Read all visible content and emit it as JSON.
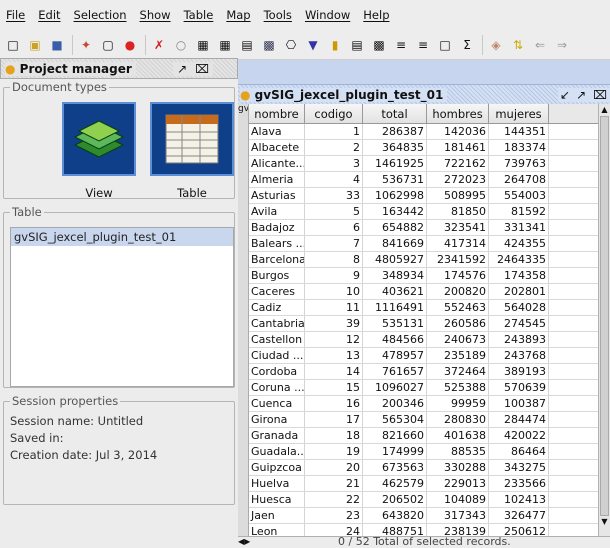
{
  "menu": [
    "File",
    "Edit",
    "Selection",
    "Show",
    "Table",
    "Map",
    "Tools",
    "Window",
    "Help"
  ],
  "toolbar_icons": [
    "new-icon",
    "open-icon",
    "save-icon",
    "wand-icon",
    "window-icon",
    "stop-icon",
    "tools-icon",
    "pointer-icon",
    "table-stats-icon",
    "table-edit-icon",
    "table-join-icon",
    "table-link-icon",
    "print-icon",
    "filter-icon",
    "selection-icon",
    "properties-icon",
    "layout-icon",
    "statistics-icon",
    "chart-icon",
    "sum-icon",
    "pan-icon",
    "sort-icon",
    "back-icon",
    "forward-icon"
  ],
  "project_manager": {
    "title": "Project manager",
    "document_types_label": "Document types",
    "doc_types": [
      {
        "name": "View",
        "icon": "view-map-icon"
      },
      {
        "name": "Table",
        "icon": "table-grid-icon"
      }
    ],
    "table_group_label": "Table",
    "tables": [
      "gvSIG_jexcel_plugin_test_01"
    ],
    "session_label": "Session properties",
    "session_name": "Session name:  Untitled",
    "saved_in": "Saved in:",
    "creation_date": "Creation date:  Jul 3, 2014"
  },
  "table_window": {
    "title": "gvSIG_jexcel_plugin_test_01",
    "side_tab": "gvS",
    "columns": [
      "nombre",
      "codigo",
      "total",
      "hombres",
      "mujeres"
    ],
    "rows": [
      [
        "Alava",
        "1",
        "286387",
        "142036",
        "144351"
      ],
      [
        "Albacete",
        "2",
        "364835",
        "181461",
        "183374"
      ],
      [
        "Alicante...",
        "3",
        "1461925",
        "722162",
        "739763"
      ],
      [
        "Almeria",
        "4",
        "536731",
        "272023",
        "264708"
      ],
      [
        "Asturias",
        "33",
        "1062998",
        "508995",
        "554003"
      ],
      [
        "Avila",
        "5",
        "163442",
        "81850",
        "81592"
      ],
      [
        "Badajoz",
        "6",
        "654882",
        "323541",
        "331341"
      ],
      [
        "Balears ...",
        "7",
        "841669",
        "417314",
        "424355"
      ],
      [
        "Barcelona",
        "8",
        "4805927",
        "2341592",
        "2464335"
      ],
      [
        "Burgos",
        "9",
        "348934",
        "174576",
        "174358"
      ],
      [
        "Caceres",
        "10",
        "403621",
        "200820",
        "202801"
      ],
      [
        "Cadiz",
        "11",
        "1116491",
        "552463",
        "564028"
      ],
      [
        "Cantabria",
        "39",
        "535131",
        "260586",
        "274545"
      ],
      [
        "Castellon",
        "12",
        "484566",
        "240673",
        "243893"
      ],
      [
        "Ciudad ...",
        "13",
        "478957",
        "235189",
        "243768"
      ],
      [
        "Cordoba",
        "14",
        "761657",
        "372464",
        "389193"
      ],
      [
        "Coruna ...",
        "15",
        "1096027",
        "525388",
        "570639"
      ],
      [
        "Cuenca",
        "16",
        "200346",
        "99959",
        "100387"
      ],
      [
        "Girona",
        "17",
        "565304",
        "280830",
        "284474"
      ],
      [
        "Granada",
        "18",
        "821660",
        "401638",
        "420022"
      ],
      [
        "Guadala...",
        "19",
        "174999",
        "88535",
        "86464"
      ],
      [
        "Guipzcoa",
        "20",
        "673563",
        "330288",
        "343275"
      ],
      [
        "Huelva",
        "21",
        "462579",
        "229013",
        "233566"
      ],
      [
        "Huesca",
        "22",
        "206502",
        "104089",
        "102413"
      ],
      [
        "Jaen",
        "23",
        "643820",
        "317343",
        "326477"
      ],
      [
        "Leon",
        "24",
        "488751",
        "238139",
        "250612"
      ]
    ],
    "status": "0 / 52 Total of selected records."
  }
}
